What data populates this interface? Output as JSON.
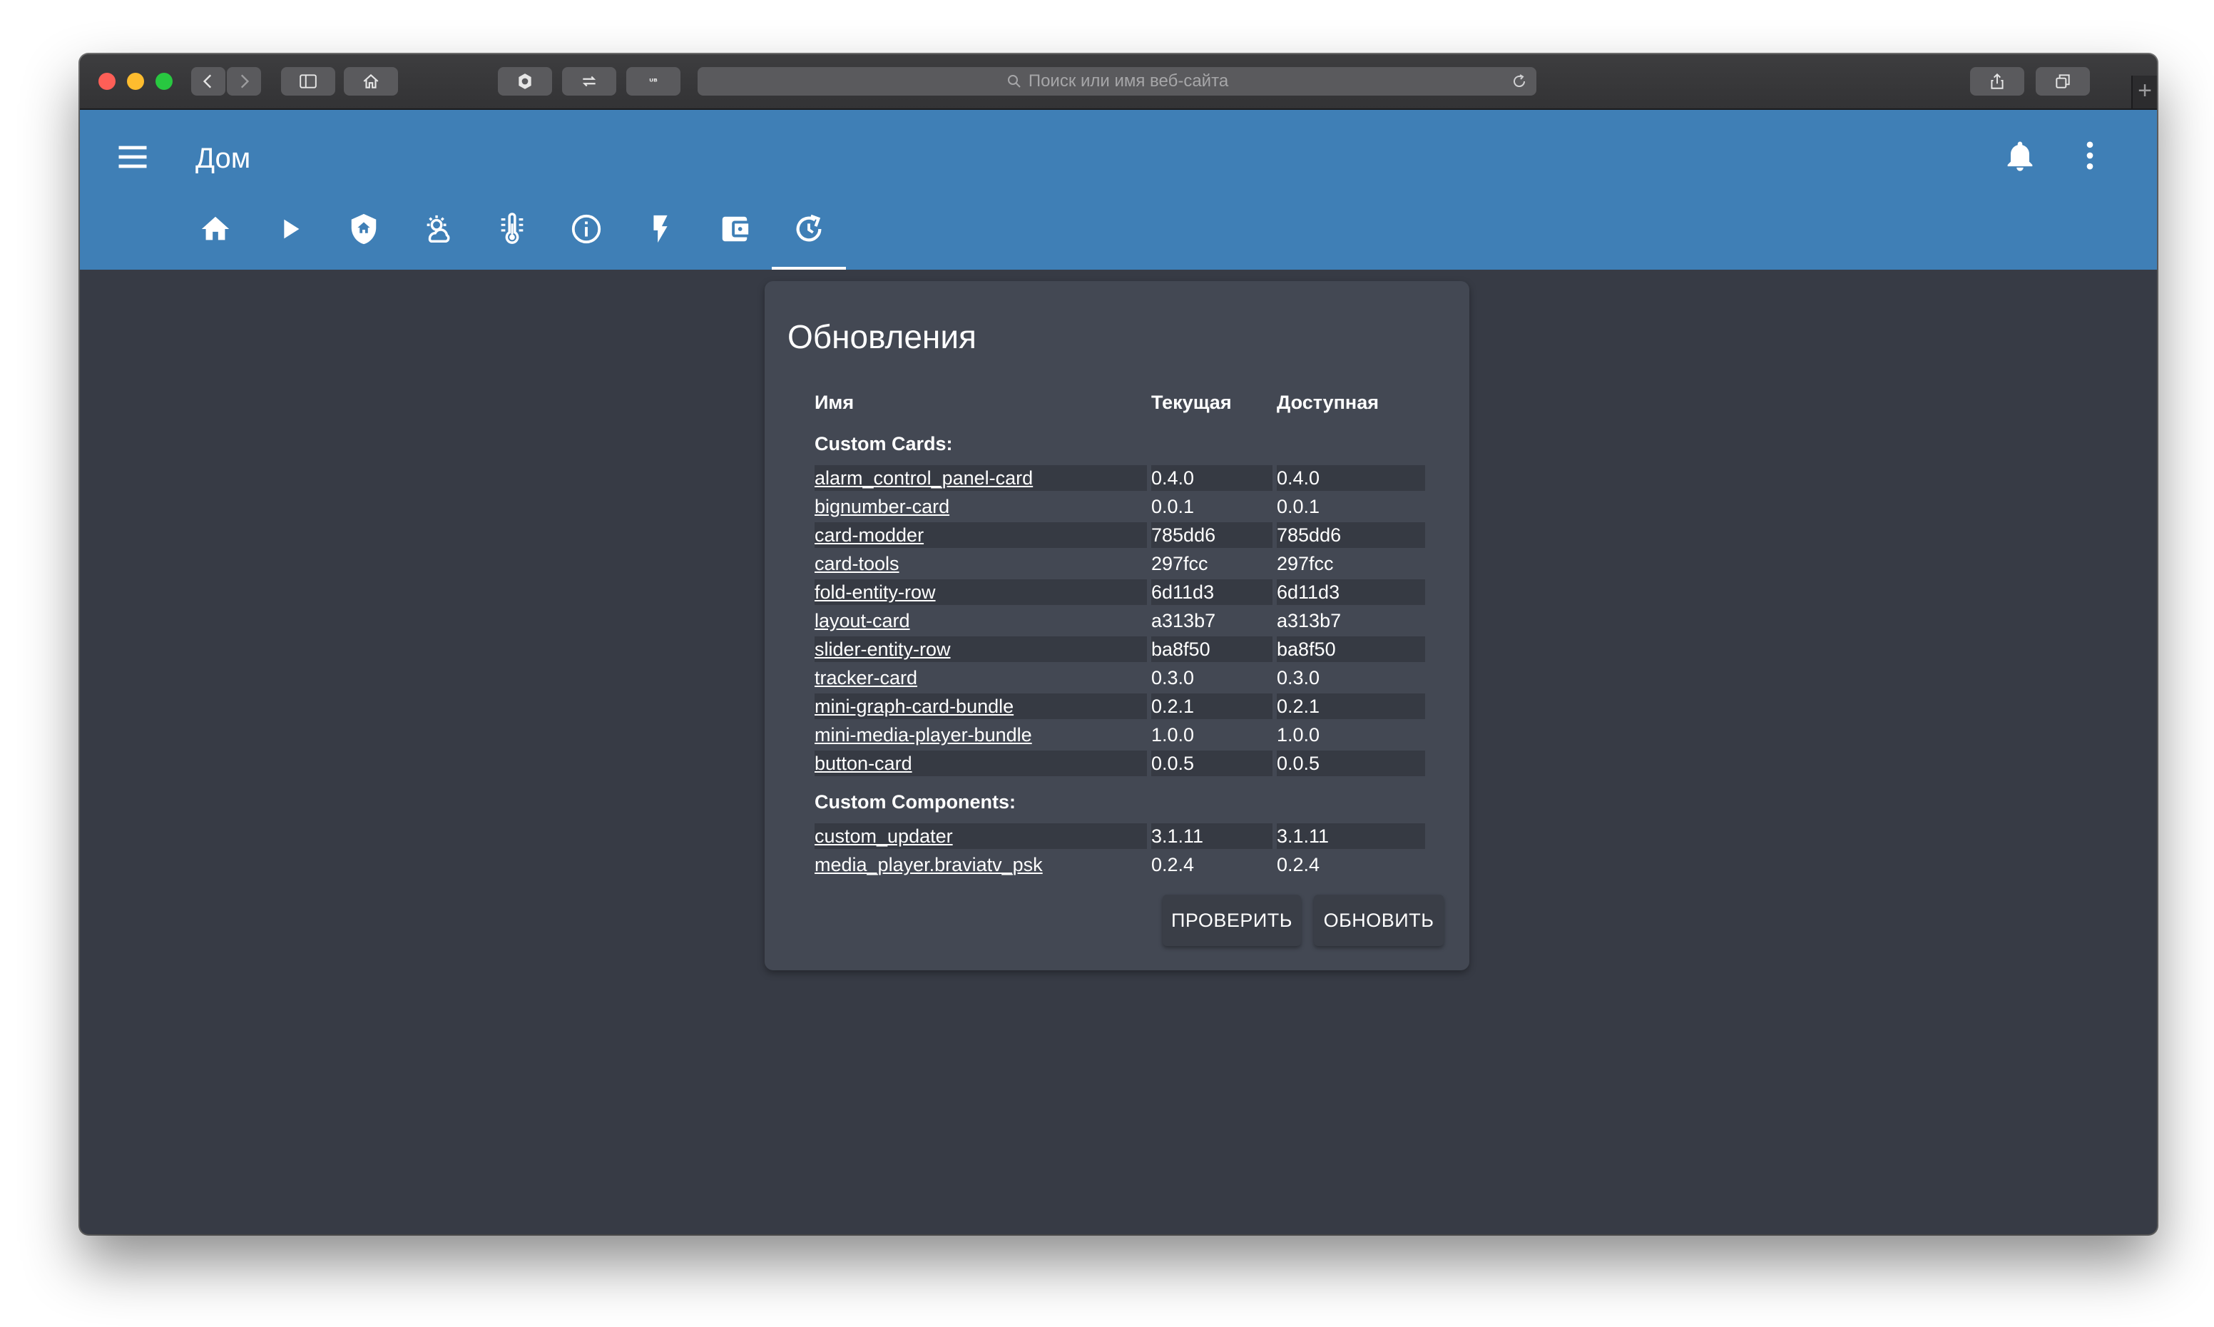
{
  "browser": {
    "url_placeholder": "Поиск или имя веб-сайта",
    "toolbar_icons": [
      "back-icon",
      "forward-icon",
      "sidebar-icon",
      "home-icon",
      "extension-icon",
      "sync-icon",
      "reader-icon",
      "share-icon",
      "tabs-icon"
    ],
    "new_tab_label": "+"
  },
  "header": {
    "title": "Дом",
    "color": "#3f7fb6",
    "tabs": [
      {
        "icon": "home-icon"
      },
      {
        "icon": "play-icon"
      },
      {
        "icon": "shield-home-icon"
      },
      {
        "icon": "weather-icon"
      },
      {
        "icon": "thermometer-icon"
      },
      {
        "icon": "info-icon"
      },
      {
        "icon": "flash-icon"
      },
      {
        "icon": "wallet-icon"
      },
      {
        "icon": "update-icon",
        "active": true
      }
    ]
  },
  "card": {
    "title": "Обновления",
    "columns": {
      "name": "Имя",
      "current": "Текущая",
      "available": "Доступная"
    },
    "sections": [
      {
        "title": "Custom Cards:",
        "rows": [
          {
            "name": "alarm_control_panel-card",
            "current": "0.4.0",
            "available": "0.4.0"
          },
          {
            "name": "bignumber-card",
            "current": "0.0.1",
            "available": "0.0.1"
          },
          {
            "name": "card-modder",
            "current": "785dd6",
            "available": "785dd6"
          },
          {
            "name": "card-tools",
            "current": "297fcc",
            "available": "297fcc"
          },
          {
            "name": "fold-entity-row",
            "current": "6d11d3",
            "available": "6d11d3"
          },
          {
            "name": "layout-card",
            "current": "a313b7",
            "available": "a313b7"
          },
          {
            "name": "slider-entity-row",
            "current": "ba8f50",
            "available": "ba8f50"
          },
          {
            "name": "tracker-card",
            "current": "0.3.0",
            "available": "0.3.0"
          },
          {
            "name": "mini-graph-card-bundle",
            "current": "0.2.1",
            "available": "0.2.1"
          },
          {
            "name": "mini-media-player-bundle",
            "current": "1.0.0",
            "available": "1.0.0"
          },
          {
            "name": "button-card",
            "current": "0.0.5",
            "available": "0.0.5"
          }
        ]
      },
      {
        "title": "Custom Components:",
        "rows": [
          {
            "name": "custom_updater",
            "current": "3.1.11",
            "available": "3.1.11"
          },
          {
            "name": "media_player.braviatv_psk",
            "current": "0.2.4",
            "available": "0.2.4"
          }
        ]
      }
    ],
    "buttons": {
      "check": "ПРОВЕРИТЬ",
      "update": "ОБНОВИТЬ"
    }
  }
}
